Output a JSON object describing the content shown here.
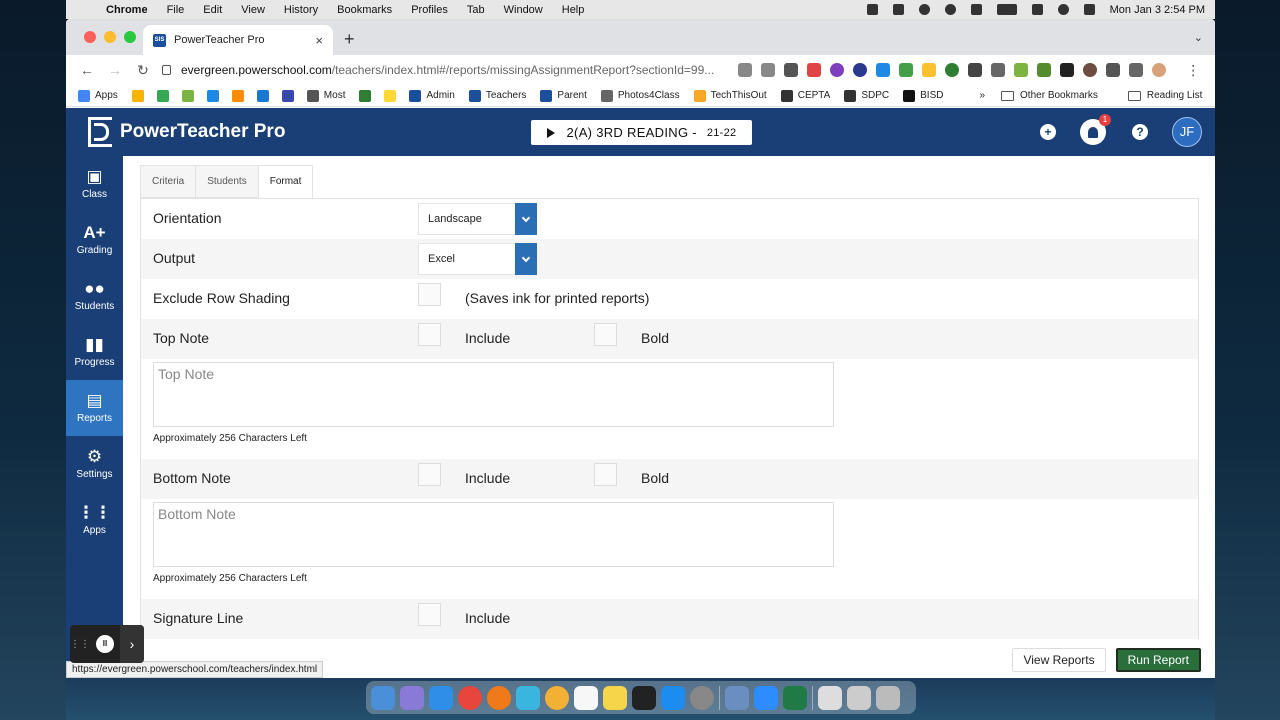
{
  "menubar": {
    "app": "Chrome",
    "menus": [
      "File",
      "Edit",
      "View",
      "History",
      "Bookmarks",
      "Profiles",
      "Tab",
      "Window",
      "Help"
    ],
    "clock": "Mon Jan 3  2:54 PM"
  },
  "browser": {
    "tab_title": "PowerTeacher Pro",
    "tab_favicon_text": "SIS",
    "url_host": "evergreen.powerschool.com",
    "url_path": "/teachers/index.html#/reports/missingAssignmentReport?sectionId=99...",
    "bookmarks": [
      {
        "label": "Apps",
        "color": "#4285f4"
      },
      {
        "label": "",
        "color": "#f4b400"
      },
      {
        "label": "",
        "color": "#34a853"
      },
      {
        "label": "",
        "color": "#7cb342"
      },
      {
        "label": "",
        "color": "#1e88e5"
      },
      {
        "label": "",
        "color": "#fb8c00"
      },
      {
        "label": "",
        "color": "#1976d2"
      },
      {
        "label": "",
        "color": "#3949ab"
      },
      {
        "label": "Most",
        "color": "#555555"
      },
      {
        "label": "",
        "color": "#2e7d32"
      },
      {
        "label": "",
        "color": "#fdd835"
      },
      {
        "label": "Admin",
        "color": "#1b4f9c"
      },
      {
        "label": "Teachers",
        "color": "#1b4f9c"
      },
      {
        "label": "Parent",
        "color": "#1b4f9c"
      },
      {
        "label": "Photos4Class",
        "color": "#666666"
      },
      {
        "label": "TechThisOut",
        "color": "#f9a825"
      },
      {
        "label": "CEPTA",
        "color": "#333333"
      },
      {
        "label": "SDPC",
        "color": "#333333"
      },
      {
        "label": "BISD",
        "color": "#111111"
      }
    ],
    "other_bookmarks": "Other Bookmarks",
    "reading_list": "Reading List"
  },
  "app": {
    "name": "PowerTeacher Pro",
    "section_label": "2(A) 3RD READING",
    "section_separator": " - ",
    "section_year": "21-22",
    "notification_count": "1",
    "user_initials": "JF"
  },
  "nav": [
    {
      "label": "Class",
      "icon": "class-icon",
      "glyph": "▣"
    },
    {
      "label": "Grading",
      "icon": "grading-icon",
      "glyph": "A+"
    },
    {
      "label": "Students",
      "icon": "students-icon",
      "glyph": "●●"
    },
    {
      "label": "Progress",
      "icon": "progress-icon",
      "glyph": "▮▮"
    },
    {
      "label": "Reports",
      "icon": "reports-icon",
      "glyph": "▤",
      "active": true
    },
    {
      "label": "Settings",
      "icon": "gear-icon",
      "glyph": "⚙"
    },
    {
      "label": "Apps",
      "icon": "apps-grid-icon",
      "glyph": "⋮⋮"
    }
  ],
  "report_tabs": [
    "Criteria",
    "Students",
    "Format"
  ],
  "format": {
    "orientation_label": "Orientation",
    "orientation_value": "Landscape",
    "output_label": "Output",
    "output_value": "Excel",
    "exclude_shading_label": "Exclude Row Shading",
    "exclude_shading_hint": "(Saves ink for printed reports)",
    "top_note_label": "Top Note",
    "top_note_placeholder": "Top Note",
    "bottom_note_label": "Bottom Note",
    "bottom_note_placeholder": "Bottom Note",
    "include_label": "Include",
    "bold_label": "Bold",
    "chars_left": "Approximately 256 Characters Left",
    "signature_label": "Signature Line"
  },
  "buttons": {
    "view_reports": "View Reports",
    "run_report": "Run Report"
  },
  "status_url": "https://evergreen.powerschool.com/teachers/index.html"
}
